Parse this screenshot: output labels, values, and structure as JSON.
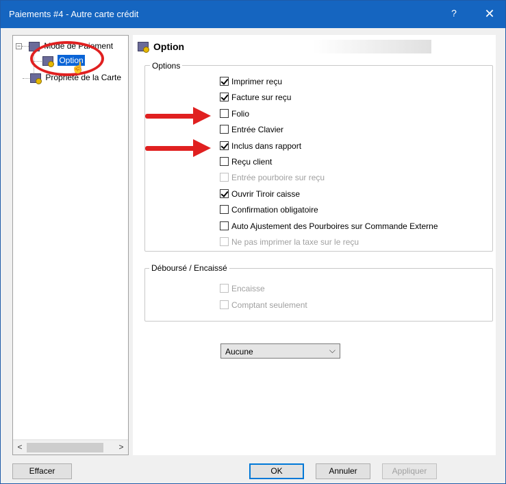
{
  "window": {
    "title": "Paiements #4 - Autre carte crédit",
    "help_label": "?",
    "close_label": "✕"
  },
  "tree": {
    "root_label": "Mode de Paiement",
    "items": [
      {
        "label": "Option"
      },
      {
        "label": "Propriété de la Carte"
      }
    ],
    "expander_symbol": "−"
  },
  "page": {
    "header_title": "Option"
  },
  "options_group": {
    "legend": "Options",
    "items": [
      {
        "label": "Imprimer reçu",
        "checked": true,
        "disabled": false
      },
      {
        "label": "Facture sur reçu",
        "checked": true,
        "disabled": false
      },
      {
        "label": "Folio",
        "checked": false,
        "disabled": false
      },
      {
        "label": "Entrée Clavier",
        "checked": false,
        "disabled": false
      },
      {
        "label": "Inclus dans rapport",
        "checked": true,
        "disabled": false
      },
      {
        "label": "Reçu client",
        "checked": false,
        "disabled": false
      },
      {
        "label": "Entrée pourboire sur reçu",
        "checked": false,
        "disabled": true
      },
      {
        "label": "Ouvrir Tiroir caisse",
        "checked": true,
        "disabled": false
      },
      {
        "label": "Confirmation obligatoire",
        "checked": false,
        "disabled": false
      },
      {
        "label": "Auto Ajustement des Pourboires sur Commande Externe",
        "checked": false,
        "disabled": false
      },
      {
        "label": "Ne pas imprimer la taxe sur le reçu",
        "checked": false,
        "disabled": true
      }
    ]
  },
  "debourse_group": {
    "legend": "Déboursé / Encaissé",
    "items": [
      {
        "label": "Encaisse",
        "checked": false,
        "disabled": true
      },
      {
        "label": "Comptant seulement",
        "checked": false,
        "disabled": true
      }
    ]
  },
  "dropdown": {
    "selected": "Aucune"
  },
  "buttons": {
    "clear": "Effacer",
    "ok": "OK",
    "cancel": "Annuler",
    "apply": "Appliquer"
  },
  "colors": {
    "titlebar": "#1565c0",
    "selection": "#0a64d6",
    "annotation_red": "#e02020"
  }
}
